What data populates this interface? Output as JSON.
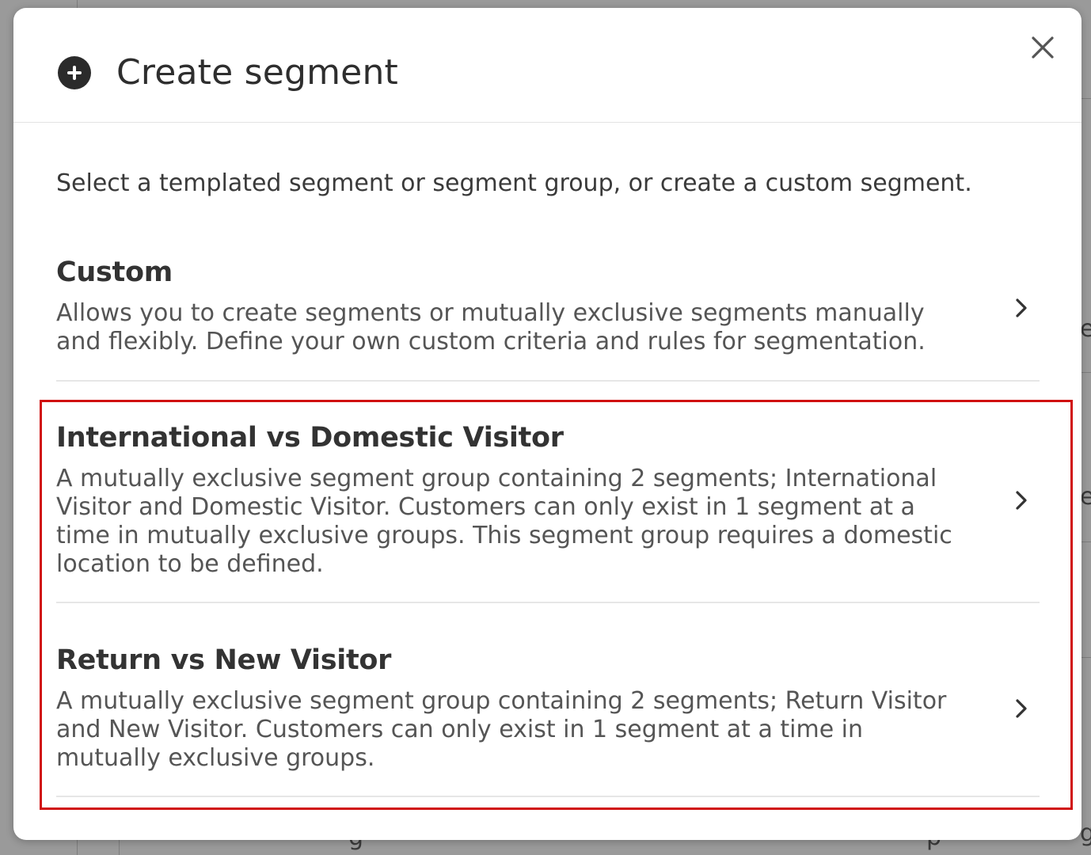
{
  "modal": {
    "title": "Create segment",
    "header_icon": "plus-circle-icon",
    "close_icon": "close-icon",
    "intro": "Select a templated segment or segment group, or create a custom segment."
  },
  "options": [
    {
      "title": "Custom",
      "description": "Allows you to create segments or mutually exclusive segments manually and flexibly. Define your own custom criteria and rules for segmentation.",
      "icon": "chevron-right-icon"
    },
    {
      "title": "International vs Domestic Visitor",
      "description": "A mutually exclusive segment group containing 2 segments; International Visitor and Domestic Visitor. Customers can only exist in 1 segment at a time in mutually exclusive groups. This segment group requires a domestic location to be defined.",
      "icon": "chevron-right-icon"
    },
    {
      "title": "Return vs New Visitor",
      "description": "A mutually exclusive segment group containing 2 segments; Return Visitor and New Visitor. Customers can only exist in 1 segment at a time in mutually exclusive groups.",
      "icon": "chevron-right-icon"
    }
  ],
  "background": {
    "fragment_1": "e",
    "fragment_2": "e",
    "fragment_3": "g",
    "fragment_4": "p",
    "fragment_5": "g"
  },
  "colors": {
    "highlight": "#d01010",
    "overlay": "#8a8a8a",
    "header_icon_bg": "#2b2b2b"
  }
}
